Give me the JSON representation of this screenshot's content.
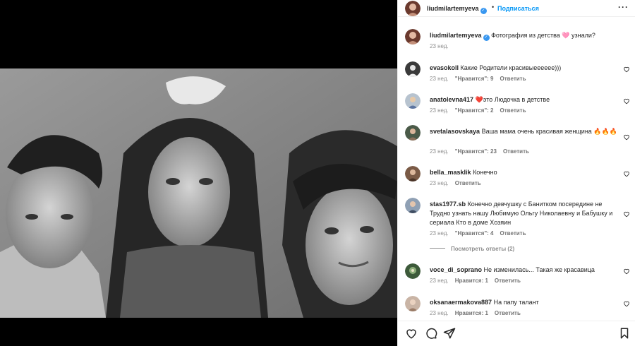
{
  "header": {
    "username": "liudmilartemyeva",
    "verified_icon": "verified-badge-icon",
    "separator": "•",
    "follow_label": "Подписаться",
    "more_label": "···"
  },
  "caption": {
    "username": "liudmilartemyeva",
    "text": "Фотография из детства 🩷 узнали?",
    "time": "23 нед."
  },
  "comments": [
    {
      "username": "evasokoll",
      "text": "Какие Родители красивыееееее)))",
      "time": "23 нед.",
      "likes": "\"Нравится\": 9",
      "reply": "Ответить",
      "avatar_color": "#3a3a3a"
    },
    {
      "username": "anatolevna417",
      "text": "❤️это Людочка в детстве",
      "time": "23 нед.",
      "likes": "\"Нравится\": 2",
      "reply": "Ответить",
      "avatar_color": "#b7c3cf"
    },
    {
      "username": "svetalasovskaya",
      "text": "Ваша мама очень красивая женщина 🔥🔥🔥",
      "time": "23 нед.",
      "likes": "\"Нравится\": 23",
      "reply": "Ответить",
      "avatar_color": "#4a5a48"
    },
    {
      "username": "bella_masklik",
      "text": "Конечно",
      "time": "23 нед.",
      "likes": "",
      "reply": "Ответить",
      "avatar_color": "#7a5a46"
    },
    {
      "username": "stas1977.sb",
      "text": "Конечно девчушку с Банитком посередине не Трудно узнать нашу Любимую Ольгу Николаевну и Бабушку и сериала Кто в доме Хозяин",
      "time": "23 нед.",
      "likes": "\"Нравится\": 4",
      "reply": "Ответить",
      "avatar_color": "#8fa0b4"
    },
    {
      "username": "voce_di_soprano",
      "text": "Не изменилась... Такая же красавица",
      "time": "23 нед.",
      "likes": "Нравится: 1",
      "reply": "Ответить",
      "avatar_color": "#3d5a3a"
    },
    {
      "username": "oksanaermakova887",
      "text": "На папу талант",
      "time": "23 нед.",
      "likes": "Нравится: 1",
      "reply": "Ответить",
      "avatar_color": "#c9b4a5"
    }
  ],
  "view_replies_label": "Посмотреть ответы (2)",
  "icons": {
    "like": "heart-icon",
    "comment": "comment-icon",
    "share": "send-icon",
    "save": "bookmark-icon"
  }
}
